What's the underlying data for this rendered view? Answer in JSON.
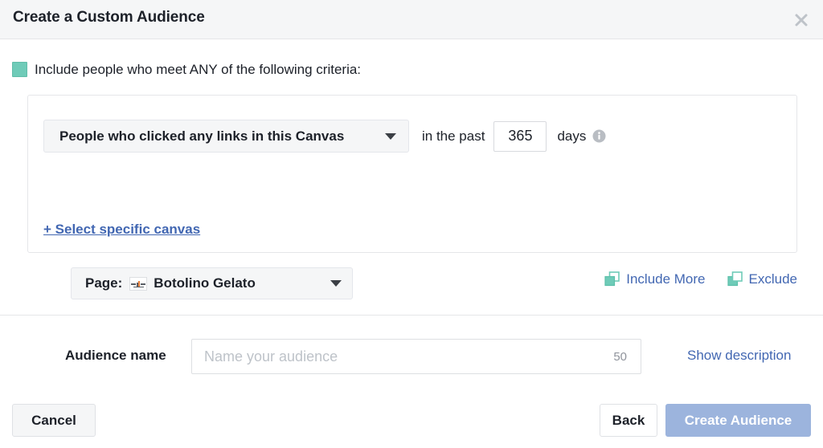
{
  "header": {
    "title": "Create a Custom Audience",
    "close_icon": "close-icon"
  },
  "include": {
    "label": "Include people who meet ANY of the following criteria:",
    "checkbox_color": "#6fcbb8",
    "checked": true
  },
  "criteria": {
    "rule": {
      "dropdown_label": "People who clicked any links in this Canvas",
      "caret_icon": "chevron-down-icon",
      "in_past_text": "in the past",
      "days_value": "365",
      "days_text": "days",
      "info_icon": "info-icon"
    },
    "page": {
      "prefix": "Page:",
      "thumbnail_icon": "page-thumbnail-icon",
      "name": "Botolino Gelato",
      "caret_icon": "chevron-down-icon"
    },
    "select_canvas_link": "+ Select specific canvas"
  },
  "actions": {
    "include_more": {
      "label": "Include More",
      "icon": "include-more-icon"
    },
    "exclude": {
      "label": "Exclude",
      "icon": "exclude-icon"
    },
    "link_color": "#4267b2"
  },
  "name_section": {
    "label": "Audience name",
    "placeholder": "Name your audience",
    "value": "",
    "char_counter": "50",
    "show_description_link": "Show description"
  },
  "footer": {
    "cancel_label": "Cancel",
    "back_label": "Back",
    "create_label": "Create Audience",
    "create_button_color": "#9cb4dd"
  }
}
